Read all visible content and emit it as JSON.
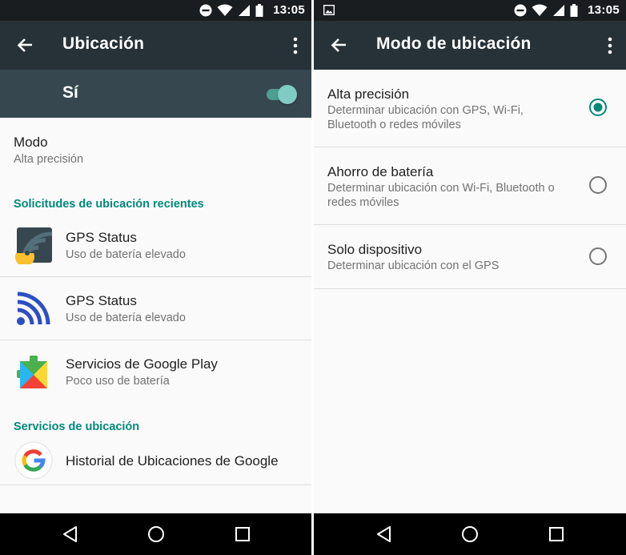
{
  "status": {
    "time": "13:05"
  },
  "left": {
    "title": "Ubicación",
    "switch_label": "Sí",
    "switch_on": true,
    "mode": {
      "title": "Modo",
      "value": "Alta precisión"
    },
    "recent_header": "Solicitudes de ubicación recientes",
    "recent": [
      {
        "title": "GPS Status",
        "subtitle": "Uso de batería elevado",
        "icon": "gps-status-radar-icon"
      },
      {
        "title": "GPS Status",
        "subtitle": "Uso de batería elevado",
        "icon": "gps-status-signal-icon"
      },
      {
        "title": "Servicios de Google Play",
        "subtitle": "Poco uso de batería",
        "icon": "google-play-services-icon"
      }
    ],
    "services_header": "Servicios de ubicación",
    "services": [
      {
        "title": "Historial de Ubicaciones de Google",
        "icon": "google-g-icon"
      }
    ]
  },
  "right": {
    "title": "Modo de ubicación",
    "options": [
      {
        "title": "Alta precisión",
        "desc1": "Determinar ubicación con GPS, Wi-Fi,",
        "desc2": "Bluetooth o redes móviles",
        "selected": true
      },
      {
        "title": "Ahorro de batería",
        "desc1": "Determinar ubicación con Wi-Fi, Bluetooth o",
        "desc2": "redes móviles",
        "selected": false
      },
      {
        "title": "Solo dispositivo",
        "desc1": "Determinar ubicación con el GPS",
        "desc2": "",
        "selected": false
      }
    ]
  },
  "colors": {
    "appbar": "#263238",
    "switchbar": "#37474f",
    "accent": "#00897b",
    "toggle_thumb": "#80cbc4"
  }
}
